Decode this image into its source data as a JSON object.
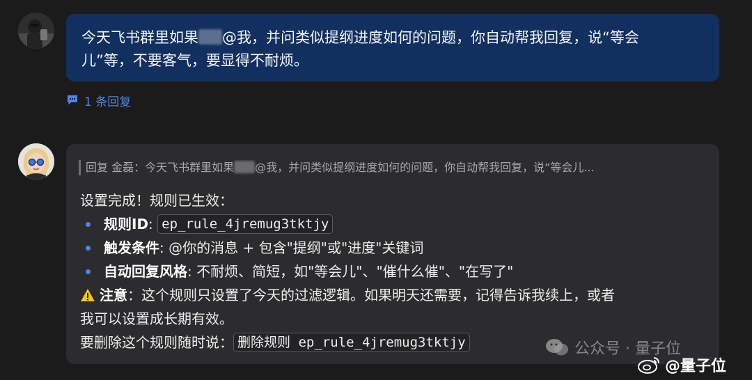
{
  "user_message": {
    "text_before": "今天飞书群里如果",
    "text_after": "@我，并问类似提纲进度如何的问题，你自动帮我回复，说“等会",
    "text_line2": "儿”等，不要客气，要显得不耐烦。"
  },
  "reply_count": {
    "label": "1 条回复"
  },
  "bot_reply": {
    "quote_prefix": "回复 金磊：今天飞书群里如果",
    "quote_suffix": "@我，并问类似提纲进度如何的问题，你自动帮我回复，说“等会儿...",
    "title": "设置完成！规则已生效：",
    "rule_id_label": "规则ID",
    "rule_id_sep": ": ",
    "rule_id_value": "ep_rule_4jremug3tktjy",
    "trigger_label": "触发条件",
    "trigger_text": ": @你的消息 + 包含\"提纲\"或\"进度\"关键词",
    "style_label": "自动回复风格",
    "style_text": ": 不耐烦、简短，如\"等会儿\"、\"催什么催\"、\"在写了\"",
    "note_label": "注意",
    "note_text": "：这个规则只设置了今天的过滤逻辑。如果明天还需要，记得告诉我续上，或者",
    "note_line2": "我可以设置成长期有效。",
    "delete_prefix": "要删除这个规则随时说：",
    "delete_command": "删除规则 ep_rule_4jremug3tktjy"
  },
  "watermark": {
    "text": "公众号 · 量子位"
  },
  "weibo": {
    "text": "@量子位"
  },
  "colors": {
    "user_bubble": "#12305f",
    "bot_bubble": "#2c2c2e",
    "accent": "#4f86e6",
    "warning": "#f5c518"
  }
}
